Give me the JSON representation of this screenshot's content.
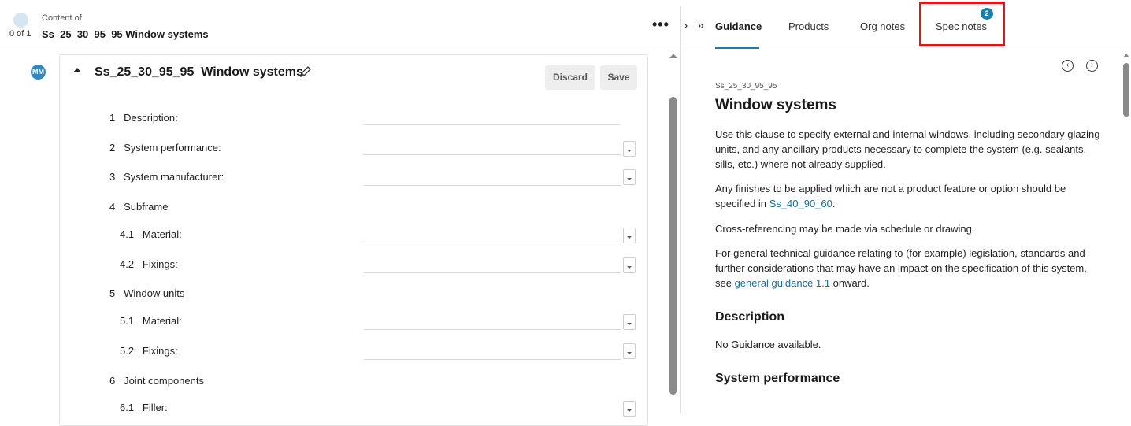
{
  "header": {
    "progress": "0 of 1",
    "content_of": "Content of",
    "title": "Ss_25_30_95_95 Window systems",
    "more_menu": "•••"
  },
  "avatar": {
    "initials": "MM"
  },
  "clause": {
    "title": "Ss_25_30_95_95  Window systems",
    "discard_label": "Discard",
    "save_label": "Save",
    "rows": [
      {
        "num": "1",
        "label": "Description:"
      },
      {
        "num": "2",
        "label": "System performance:"
      },
      {
        "num": "3",
        "label": "System manufacturer:"
      },
      {
        "num": "4",
        "label": "Subframe"
      },
      {
        "num": "4.1",
        "label": "Material:"
      },
      {
        "num": "4.2",
        "label": "Fixings:"
      },
      {
        "num": "5",
        "label": "Window units"
      },
      {
        "num": "5.1",
        "label": "Material:"
      },
      {
        "num": "5.2",
        "label": "Fixings:"
      },
      {
        "num": "6",
        "label": "Joint components"
      },
      {
        "num": "6.1",
        "label": "Filler:"
      }
    ]
  },
  "tabs": {
    "guidance": "Guidance",
    "products": "Products",
    "org_notes": "Org notes",
    "spec_notes": "Spec notes",
    "spec_notes_badge": "2"
  },
  "nav": {
    "chevron": "›",
    "double_chevron": "»",
    "prev": "‹",
    "next": "›"
  },
  "guidance": {
    "code": "Ss_25_30_95_95",
    "title": "Window systems",
    "p1": "Use this clause to specify external and internal windows, including secondary glazing units, and any ancillary products necessary to complete the system (e.g. sealants, sills, etc.) where not already supplied.",
    "p2_before": "Any finishes to be applied which are not a product feature or option should be specified in ",
    "p2_link": "Ss_40_90_60",
    "p2_after": ".",
    "p3": "Cross-referencing may be made via schedule or drawing.",
    "p4_before": "For general technical guidance relating to (for example) legislation, standards and further considerations that may have an impact on the specification of this system, see ",
    "p4_link": "general guidance 1.1",
    "p4_after": " onward.",
    "description_heading": "Description",
    "description_text": "No Guidance available.",
    "performance_heading": "System performance"
  },
  "colors": {
    "accent": "#1a7ea6",
    "highlight": "#e0161b",
    "avatar": "#2e88c6"
  }
}
